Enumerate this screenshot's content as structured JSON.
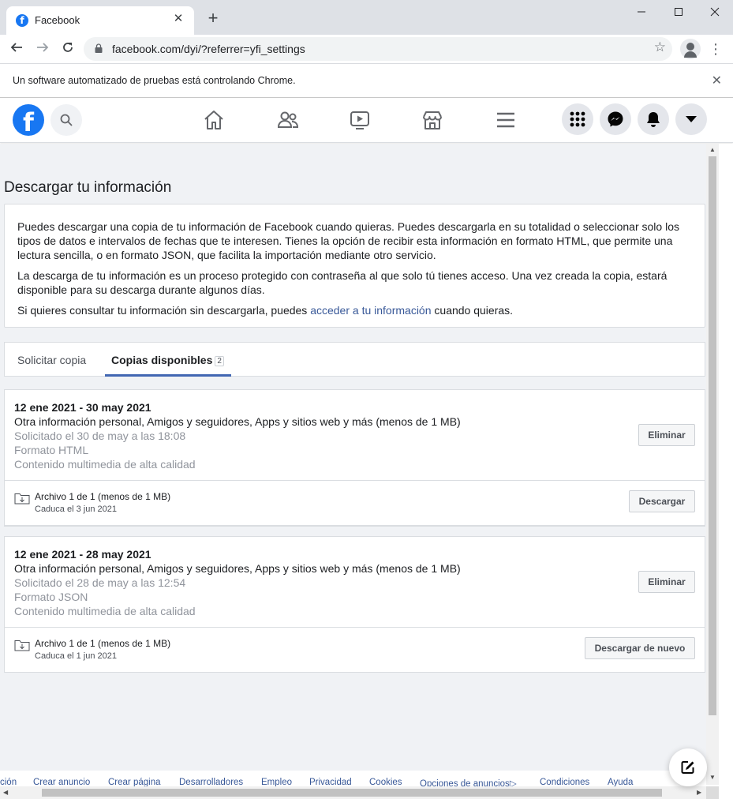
{
  "browser": {
    "tab_title": "Facebook",
    "favicon_letter": "f",
    "url": "facebook.com/dyi/?referrer=yfi_settings",
    "automation_notice": "Un software automatizado de pruebas está controlando Chrome."
  },
  "header": {
    "logo_letter": "f"
  },
  "page": {
    "title": "Descargar tu información",
    "intro": {
      "p1": "Puedes descargar una copia de tu información de Facebook cuando quieras. Puedes descargarla en su totalidad o seleccionar solo los tipos de datos e intervalos de fechas que te interesen. Tienes la opción de recibir esta información en formato HTML, que permite una lectura sencilla, o en formato JSON, que facilita la importación mediante otro servicio.",
      "p2": "La descarga de tu información es un proceso protegido con contraseña al que solo tú tienes acceso. Una vez creada la copia, estará disponible para su descarga durante algunos días.",
      "p3_before": "Si quieres consultar tu información sin descargarla, puedes",
      "p3_link": "acceder a tu información",
      "p3_after": "cuando quieras."
    },
    "tabs": [
      {
        "label": "Solicitar copia",
        "active": false
      },
      {
        "label": "Copias disponibles",
        "active": true,
        "count": "2"
      }
    ],
    "copies": [
      {
        "range": "12 ene 2021 - 30 may 2021",
        "description": "Otra información personal, Amigos y seguidores, Apps y sitios web y más (menos de 1 MB)",
        "requested": "Solicitado el 30 de may a las 18:08",
        "format": "Formato HTML",
        "quality": "Contenido multimedia de alta calidad",
        "delete_label": "Eliminar",
        "file_name": "Archivo 1 de 1 (menos de 1 MB)",
        "expires": "Caduca el 3 jun 2021",
        "download_label": "Descargar"
      },
      {
        "range": "12 ene 2021 - 28 may 2021",
        "description": "Otra información personal, Amigos y seguidores, Apps y sitios web y más (menos de 1 MB)",
        "requested": "Solicitado el 28 de may a las 12:54",
        "format": "Formato JSON",
        "quality": "Contenido multimedia de alta calidad",
        "delete_label": "Eliminar",
        "file_name": "Archivo 1 de 1 (menos de 1 MB)",
        "expires": "Caduca el 1 jun 2021",
        "download_label": "Descargar de nuevo"
      }
    ]
  },
  "footer": {
    "links": [
      "ción",
      "Crear anuncio",
      "Crear página",
      "Desarrolladores",
      "Empleo",
      "Privacidad",
      "Cookies",
      "Opciones de anuncios",
      "Condiciones",
      "Ayuda"
    ]
  },
  "colors": {
    "facebook_blue": "#1877f2",
    "link_blue": "#385898",
    "tab_underline": "#4267b2",
    "page_background": "#f0f2f5"
  },
  "icons": [
    "facebook-logo-icon",
    "search-icon",
    "home-icon",
    "friends-icon",
    "watch-icon",
    "marketplace-icon",
    "menu-icon",
    "apps-grid-icon",
    "messenger-icon",
    "notifications-icon",
    "account-dropdown-icon",
    "compose-icon",
    "download-file-icon"
  ]
}
